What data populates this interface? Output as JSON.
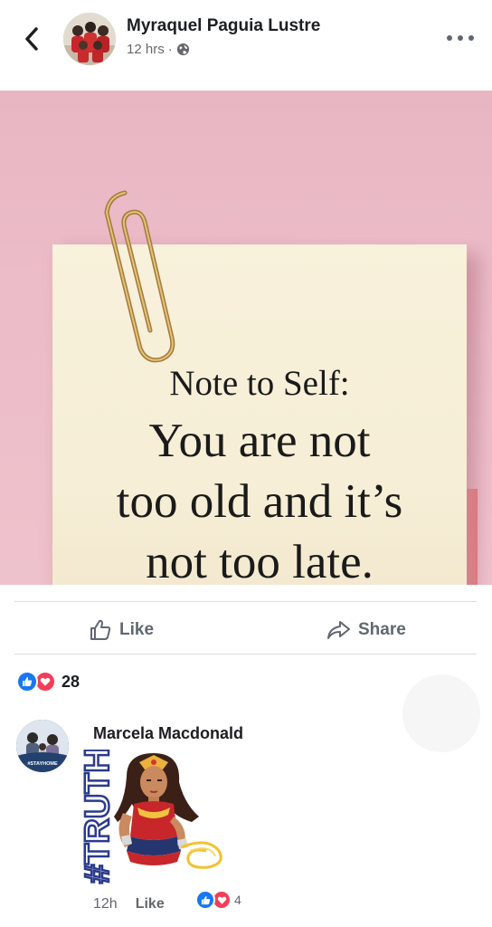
{
  "header": {
    "poster_name": "Myraquel Paguia Lustre",
    "time": "12 hrs",
    "separator": "·",
    "privacy_icon": "globe-icon",
    "back_icon": "chevron-left-icon",
    "more_icon": "more-dots-icon"
  },
  "photo": {
    "note_heading": "Note to Self:",
    "note_lines": [
      "You are not",
      "too old and it’s",
      "not too late."
    ],
    "badge_icon": "person-icon"
  },
  "actions": {
    "like_label": "Like",
    "share_label": "Share"
  },
  "reactions": {
    "count": "28",
    "icons": [
      "like-reaction-icon",
      "love-reaction-icon"
    ]
  },
  "comment": {
    "author": "Marcela Macdonald",
    "sticker_text": "#TRUTH",
    "avatar_tag": "#STAYHOME",
    "time": "12h",
    "like_label": "Like",
    "reaction_count": "4"
  },
  "colors": {
    "like_blue": "#1877f2",
    "love_red": "#f33e58",
    "secondary_text": "#65676b",
    "photo_pink": "#ecbcc8",
    "note_cream": "#f7f0d8"
  }
}
